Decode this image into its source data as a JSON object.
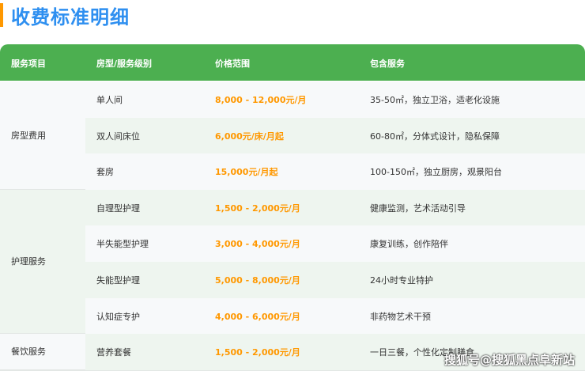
{
  "title": "收费标准明细",
  "header": [
    "服务项目",
    "房型/服务级别",
    "价格范围",
    "包含服务"
  ],
  "colors": {
    "header": "#4caf50",
    "price": "#ff9800",
    "title": "#2e8ff0",
    "accent": "#ff9800"
  },
  "categories": [
    {
      "label": "房型费用",
      "rows": 3
    },
    {
      "label": "护理服务",
      "rows": 4
    },
    {
      "label": "餐饮服务",
      "rows": 1
    }
  ],
  "rows": [
    {
      "level": "单人间",
      "price": "8,000 - 12,000元/月",
      "services": "35-50㎡，独立卫浴，适老化设施"
    },
    {
      "level": "双人间床位",
      "price": "6,000元/床/月起",
      "services": "60-80㎡，分体式设计，隐私保障"
    },
    {
      "level": "套房",
      "price": "15,000元/月起",
      "services": "100-150㎡，独立厨房，观景阳台"
    },
    {
      "level": "自理型护理",
      "price": "1,500 - 2,000元/月",
      "services": "健康监测，艺术活动引导"
    },
    {
      "level": "半失能型护理",
      "price": "3,000 - 4,000元/月",
      "services": "康复训练，创作陪伴"
    },
    {
      "level": "失能型护理",
      "price": "5,000 - 8,000元/月",
      "services": "24小时专业特护"
    },
    {
      "level": "认知症专护",
      "price": "4,000 - 6,000元/月",
      "services": "非药物艺术干预"
    },
    {
      "level": "营养套餐",
      "price": "1,500 - 2,000元/月",
      "services": "一日三餐，个性化定制膳食"
    }
  ],
  "watermark": "搜狐号@搜狐黑点阜新站"
}
